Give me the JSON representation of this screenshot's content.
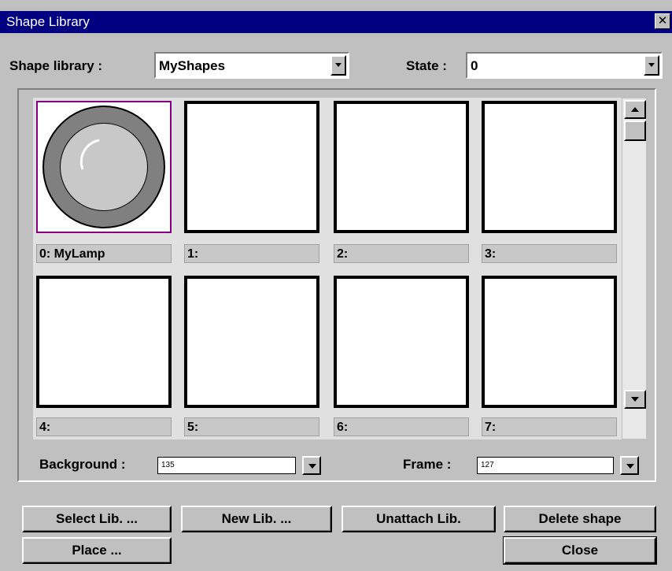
{
  "window": {
    "title": "Shape Library",
    "close_glyph": "✕"
  },
  "top": {
    "library_label": "Shape library :",
    "library_value": "MyShapes",
    "state_label": "State :",
    "state_value": "0"
  },
  "shapes": [
    {
      "caption": "0: MyLamp"
    },
    {
      "caption": "1:"
    },
    {
      "caption": "2:"
    },
    {
      "caption": "3:"
    },
    {
      "caption": "4:"
    },
    {
      "caption": "5:"
    },
    {
      "caption": "6:"
    },
    {
      "caption": "7:"
    }
  ],
  "colors": {
    "background_label": "Background :",
    "background_value": "135",
    "frame_label": "Frame :",
    "frame_value": "127"
  },
  "buttons": {
    "select_lib": "Select Lib. ...",
    "new_lib": "New Lib. ...",
    "unattach_lib": "Unattach Lib.",
    "delete_shape": "Delete shape",
    "place": "Place ...",
    "close": "Close"
  },
  "theme": {
    "titlebar": "#000080",
    "selection": "#800080",
    "face": "#c0c0c0"
  }
}
